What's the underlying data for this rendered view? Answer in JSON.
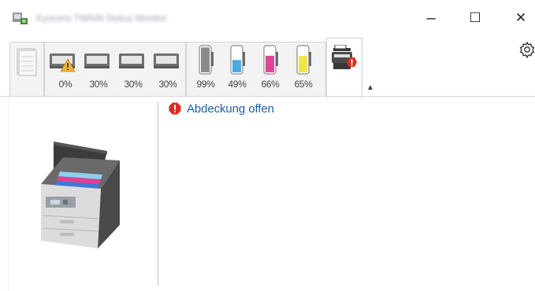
{
  "window": {
    "title": "Kyocera TWAIN Status Monitor",
    "controls": {
      "minimize": "–",
      "maximize": "☐",
      "close": "✕"
    }
  },
  "toolbar": {
    "trays": [
      {
        "label": "0%",
        "warning": true
      },
      {
        "label": "30%"
      },
      {
        "label": "30%"
      },
      {
        "label": "30%"
      }
    ],
    "toners": [
      {
        "label": "99%",
        "color": "#8a8a8a",
        "level": 0.99
      },
      {
        "label": "49%",
        "color": "#4aa9e0",
        "level": 0.49
      },
      {
        "label": "66%",
        "color": "#e0449a",
        "level": 0.66
      },
      {
        "label": "65%",
        "color": "#f2e34a",
        "level": 0.65
      }
    ],
    "collapse_icon": "▲"
  },
  "status": {
    "message": "Abdeckung offen",
    "icon": "error-icon",
    "icon_color": "#d92d20"
  },
  "colors": {
    "accent_text": "#1b5faa",
    "error": "#d92d20",
    "warning": "#f2b233"
  }
}
